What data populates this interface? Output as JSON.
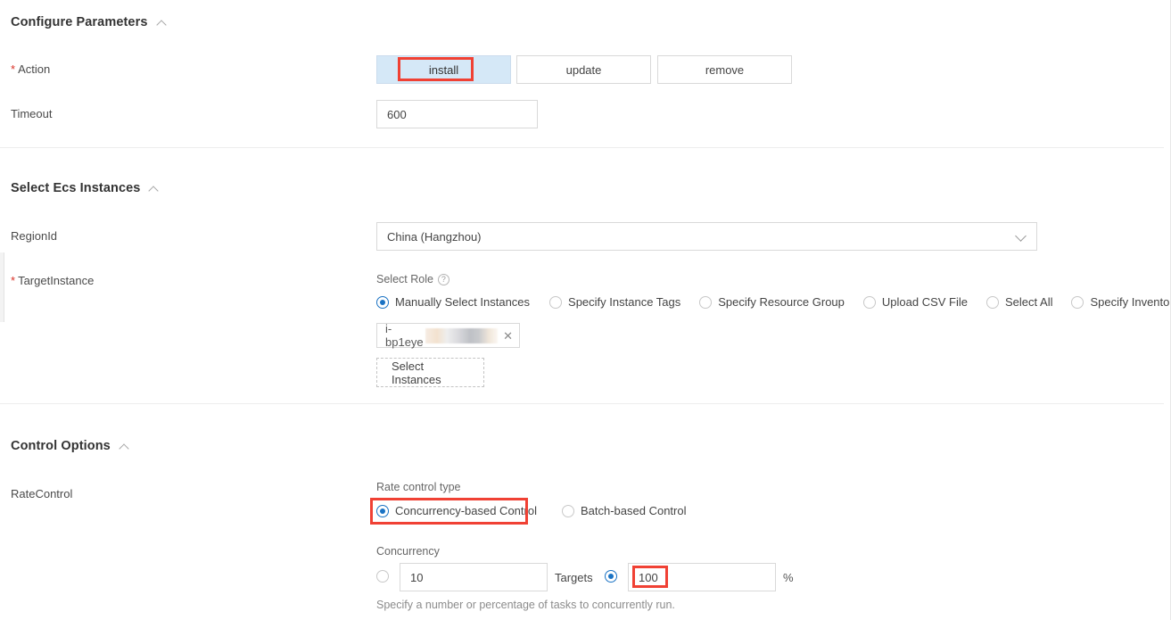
{
  "sections": [
    {
      "title": "Configure Parameters",
      "collapse_icon": "chevron-up-icon"
    },
    {
      "title": "Select Ecs Instances",
      "collapse_icon": "chevron-up-icon"
    },
    {
      "title": "Control Options",
      "collapse_icon": "chevron-up-icon"
    }
  ],
  "configure_parameters": {
    "action": {
      "label": "Action",
      "required_marker": "*",
      "options": [
        "install",
        "update",
        "remove"
      ],
      "selected": "install"
    },
    "timeout": {
      "label": "Timeout",
      "value": "600"
    }
  },
  "select_ecs_instances": {
    "region": {
      "label": "RegionId",
      "value": "China (Hangzhou)",
      "chevron": "chevron-down-icon"
    },
    "target_instance": {
      "label": "TargetInstance",
      "required_marker": "*",
      "select_role_label": "Select Role",
      "help_icon": "?",
      "role_options": [
        "Manually Select Instances",
        "Specify Instance Tags",
        "Specify Resource Group",
        "Upload CSV File",
        "Select All",
        "Specify Inventory Conditions"
      ],
      "role_selected": "Manually Select Instances",
      "instance_chip": {
        "text": "i-bp1eye",
        "redacted": true,
        "close_icon": "close-icon"
      },
      "select_instances_button": "Select Instances"
    }
  },
  "control_options": {
    "rate_control": {
      "label": "RateControl",
      "rate_control_type_label": "Rate control type",
      "type_options": [
        "Concurrency-based Control",
        "Batch-based Control"
      ],
      "type_selected": "Concurrency-based Control",
      "concurrency_label": "Concurrency",
      "concurrency_value": "10",
      "concurrency_mode_selected": "targets",
      "targets_label": "Targets",
      "targets_value": "100",
      "percent_symbol": "%",
      "hint": "Specify a number or percentage of tasks to concurrently run."
    }
  },
  "annotations": {
    "color": "#f04134",
    "highlighted": [
      "install",
      "Concurrency-based Control",
      "100"
    ]
  }
}
